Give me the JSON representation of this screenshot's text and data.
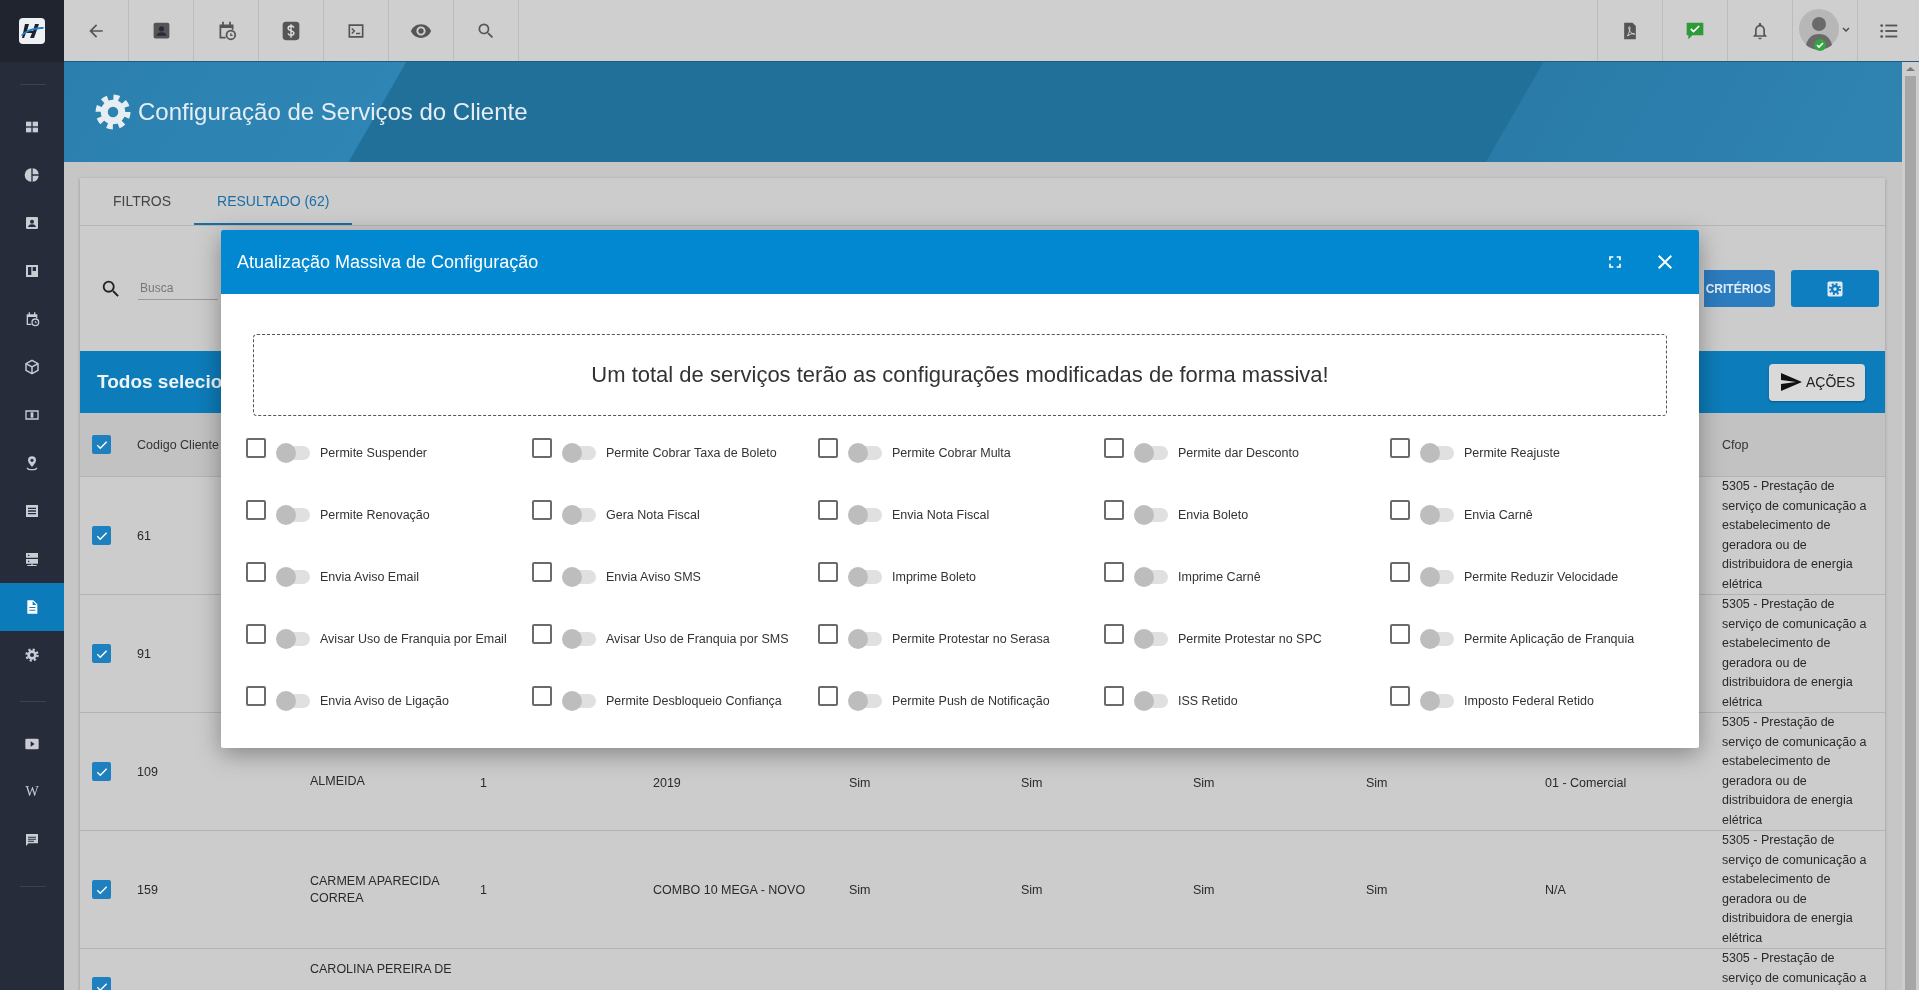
{
  "sidebar": {
    "groups": [
      {
        "items": [
          {
            "selected": false
          },
          {
            "selected": false
          },
          {
            "selected": false
          },
          {
            "selected": false
          },
          {
            "selected": false
          },
          {
            "selected": false
          },
          {
            "selected": false
          },
          {
            "selected": false
          },
          {
            "selected": false
          },
          {
            "selected": false
          },
          {
            "selected": true
          },
          {
            "selected": false
          }
        ]
      },
      {
        "items": [
          {
            "selected": false
          },
          {
            "selected": false,
            "glyph": "W"
          },
          {
            "selected": false
          }
        ]
      }
    ]
  },
  "header": {
    "title": "Configuração de Serviços do Cliente"
  },
  "tabs": [
    {
      "label": "FILTROS",
      "selected": false
    },
    {
      "label": "RESULTADO (62)",
      "selected": true
    }
  ],
  "search": {
    "placeholder": "Busca"
  },
  "criteria_button": {
    "label": "CRITÉRIOS"
  },
  "selection_bar": {
    "title": "Todos selecio",
    "action": "AÇÕES"
  },
  "table": {
    "select_all_checked": true,
    "columns": [
      "Codigo Cliente",
      "Cfop"
    ],
    "rows": [
      {
        "checked": true,
        "codigo_cliente": "61",
        "cfop": "5305 - Prestação de serviço de comunicação a estabelecimento de geradora ou de distribuidora de energia elétrica"
      },
      {
        "checked": true,
        "codigo_cliente": "91",
        "cfop": "5305 - Prestação de serviço de comunicação a estabelecimento de geradora ou de distribuidora de energia elétrica"
      },
      {
        "checked": true,
        "codigo_cliente": "109",
        "column_3": "ALMEIDA",
        "column_4": "1",
        "column_5": "2019",
        "column_6": "Sim",
        "column_7": "Sim",
        "column_8": "Sim",
        "column_9": "Sim",
        "column_10": "01 - Comercial",
        "cfop": "5305 - Prestação de serviço de comunicação a estabelecimento de geradora ou de distribuidora de energia elétrica"
      },
      {
        "checked": true,
        "codigo_cliente": "159",
        "column_3": "CARMEM APARECIDA CORREA",
        "column_4": "1",
        "column_5": "COMBO 10 MEGA - NOVO",
        "column_6": "Sim",
        "column_7": "Sim",
        "column_8": "Sim",
        "column_9": "Sim",
        "column_10": "N/A",
        "cfop": "5305 - Prestação de serviço de comunicação a estabelecimento de geradora ou de distribuidora de energia elétrica"
      },
      {
        "checked": true,
        "column_3": "CAROLINA PEREIRA DE",
        "cfop": "5305 - Prestação de serviço de comunicação a"
      }
    ]
  },
  "modal": {
    "title": "Atualização Massiva de Configuração",
    "message": "Um total de serviços terão as configurações modificadas de forma massiva!",
    "options": [
      {
        "label": "Permite Suspender",
        "checked": false,
        "on": false
      },
      {
        "label": "Permite Cobrar Taxa de Boleto",
        "checked": false,
        "on": false
      },
      {
        "label": "Permite Cobrar Multa",
        "checked": false,
        "on": false
      },
      {
        "label": "Permite dar Desconto",
        "checked": false,
        "on": false
      },
      {
        "label": "Permite Reajuste",
        "checked": false,
        "on": false
      },
      {
        "label": "Permite Renovação",
        "checked": false,
        "on": false
      },
      {
        "label": "Gera Nota Fiscal",
        "checked": false,
        "on": false
      },
      {
        "label": "Envia Nota Fiscal",
        "checked": false,
        "on": false
      },
      {
        "label": "Envia Boleto",
        "checked": false,
        "on": false
      },
      {
        "label": "Envia Carnê",
        "checked": false,
        "on": false
      },
      {
        "label": "Envia Aviso Email",
        "checked": false,
        "on": false
      },
      {
        "label": "Envia Aviso SMS",
        "checked": false,
        "on": false
      },
      {
        "label": "Imprime Boleto",
        "checked": false,
        "on": false
      },
      {
        "label": "Imprime Carnê",
        "checked": false,
        "on": false
      },
      {
        "label": "Permite Reduzir Velocidade",
        "checked": false,
        "on": false
      },
      {
        "label": "Avisar Uso de Franquia por Email",
        "checked": false,
        "on": false
      },
      {
        "label": "Avisar Uso de Franquia por SMS",
        "checked": false,
        "on": false
      },
      {
        "label": "Permite Protestar no Serasa",
        "checked": false,
        "on": false
      },
      {
        "label": "Permite Protestar no SPC",
        "checked": false,
        "on": false
      },
      {
        "label": "Permite Aplicação de Franquia",
        "checked": false,
        "on": false
      },
      {
        "label": "Envia Aviso de Ligação",
        "checked": false,
        "on": false
      },
      {
        "label": "Permite Desbloqueio Confiança",
        "checked": false,
        "on": false
      },
      {
        "label": "Permite Push de Notificação",
        "checked": false,
        "on": false
      },
      {
        "label": "ISS Retido",
        "checked": false,
        "on": false
      },
      {
        "label": "Imposto Federal Retido",
        "checked": false,
        "on": false
      }
    ]
  }
}
